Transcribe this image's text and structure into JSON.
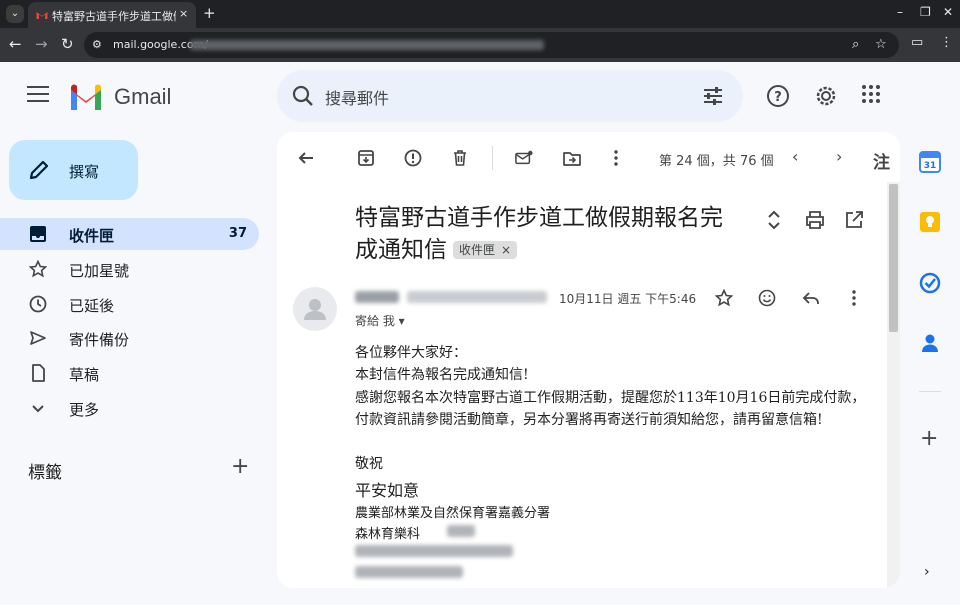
{
  "browser": {
    "tab_title": "特富野古道手作步道工做假期報",
    "tab_close": "×",
    "new_tab": "+",
    "url": "mail.google.com/",
    "window_controls": [
      "–",
      "❐",
      "✕"
    ]
  },
  "header": {
    "brand": "Gmail",
    "search_placeholder": "搜尋郵件"
  },
  "sidebar": {
    "compose_label": "撰寫",
    "items": [
      {
        "label": "收件匣",
        "count": "37",
        "icon": "inbox-icon",
        "active": true
      },
      {
        "label": "已加星號",
        "icon": "star-icon"
      },
      {
        "label": "已延後",
        "icon": "clock-icon"
      },
      {
        "label": "寄件備份",
        "icon": "send-icon"
      },
      {
        "label": "草稿",
        "icon": "draft-icon"
      },
      {
        "label": "更多",
        "icon": "chevron-down-icon"
      }
    ],
    "labels_title": "標籤",
    "labels_add": "+"
  },
  "toolbar": {
    "pager": "第 24 個，共 76 個",
    "last_glyph": "注"
  },
  "email": {
    "subject": "特富野古道手作步道工做假期報名完成通知信",
    "label_tag": "收件匣",
    "tag_remove": "×",
    "date": "10月11日 週五 下午5:46",
    "to_line": "寄給 我 ▾",
    "greeting": "各位夥伴大家好：",
    "line1": "本封信件為報名完成通知信!",
    "line2": "感謝您報名本次特富野古道工作假期活動，提醒您於113年10月16日前完成付款，",
    "line3": "付款資訊請參閱活動簡章，另本分署將再寄送行前須知給您，請再留意信箱!",
    "closing": "敬祝",
    "wish": "平安如意",
    "org": "農業部林業及自然保育署嘉義分署",
    "dept": "森林育樂科"
  },
  "side_panel": {
    "calendar_day": "31",
    "add": "+",
    "expand": "›"
  },
  "colors": {
    "background": "#f6f8fc",
    "compose": "#c2e7ff",
    "active_nav": "#d3e3fd",
    "search": "#eaf1fb",
    "chrome_dark": "#202124"
  }
}
